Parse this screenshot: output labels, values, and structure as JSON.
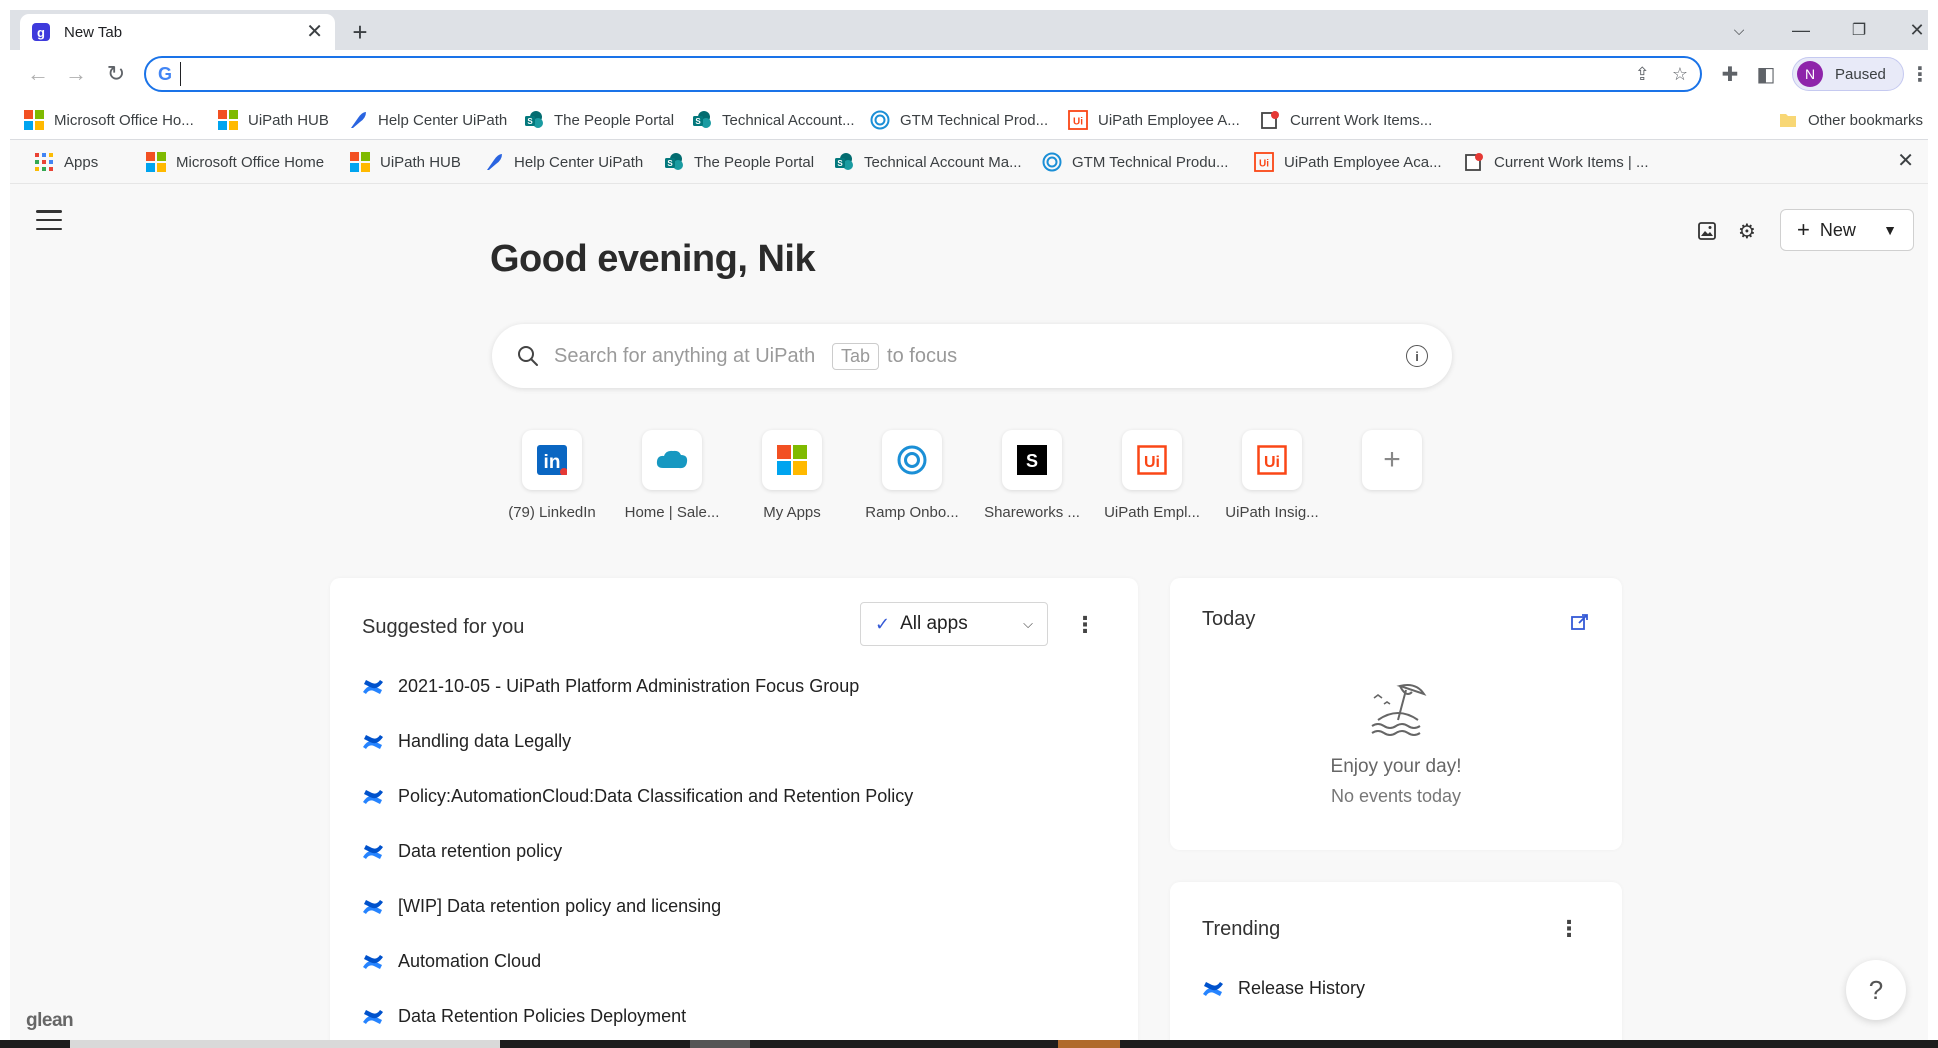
{
  "browser": {
    "tab_title": "New Tab",
    "tab_favicon_letter": "g",
    "omnibox_value": "",
    "profile_initial": "N",
    "profile_status": "Paused",
    "accent": "#1a73e8"
  },
  "bookmarks_bar": {
    "items": [
      {
        "label": "Microsoft Office Ho...",
        "icon": "microsoft-icon"
      },
      {
        "label": "UiPath HUB",
        "icon": "microsoft-icon"
      },
      {
        "label": "Help Center UiPath",
        "icon": "feather-icon"
      },
      {
        "label": "The People Portal",
        "icon": "sharepoint-icon"
      },
      {
        "label": "Technical Account...",
        "icon": "sharepoint-icon"
      },
      {
        "label": "GTM Technical Prod...",
        "icon": "ramp-icon"
      },
      {
        "label": "UiPath Employee A...",
        "icon": "uipath-icon"
      },
      {
        "label": "Current Work Items...",
        "icon": "document-icon"
      }
    ],
    "other_label": "Other bookmarks"
  },
  "app_bar": {
    "items": [
      {
        "label": "Apps",
        "icon": "apps-grid-icon"
      },
      {
        "label": "Microsoft Office Home",
        "icon": "microsoft-icon"
      },
      {
        "label": "UiPath HUB",
        "icon": "microsoft-icon"
      },
      {
        "label": "Help Center UiPath",
        "icon": "feather-icon"
      },
      {
        "label": "The People Portal",
        "icon": "sharepoint-icon"
      },
      {
        "label": "Technical Account Ma...",
        "icon": "sharepoint-icon"
      },
      {
        "label": "GTM Technical Produ...",
        "icon": "ramp-icon"
      },
      {
        "label": "UiPath Employee Aca...",
        "icon": "uipath-icon"
      },
      {
        "label": "Current Work Items | ...",
        "icon": "document-icon"
      }
    ]
  },
  "page": {
    "greeting": "Good evening, Nik",
    "search_placeholder": "Search for anything at UiPath",
    "search_kbd": "Tab",
    "search_focus_hint": "to focus",
    "new_button_label": "New",
    "logo_text": "glean"
  },
  "shortcuts": [
    {
      "label": "(79) LinkedIn",
      "icon": "linkedin-icon"
    },
    {
      "label": "Home | Sale...",
      "icon": "salesforce-icon"
    },
    {
      "label": "My Apps",
      "icon": "microsoft-icon"
    },
    {
      "label": "Ramp Onbo...",
      "icon": "ramp-icon"
    },
    {
      "label": "Shareworks ...",
      "icon": "shareworks-icon"
    },
    {
      "label": "UiPath Empl...",
      "icon": "uipath-icon"
    },
    {
      "label": "UiPath Insig...",
      "icon": "uipath-icon"
    }
  ],
  "suggested": {
    "title": "Suggested for you",
    "filter_label": "All apps",
    "items": [
      "2021-10-05 - UiPath Platform Administration Focus Group",
      "Handling data Legally",
      "Policy:AutomationCloud:Data Classification and Retention Policy",
      "Data retention policy",
      "[WIP] Data retention policy and licensing",
      "Automation Cloud",
      "Data Retention Policies Deployment"
    ]
  },
  "today": {
    "title": "Today",
    "empty_title": "Enjoy your day!",
    "empty_subtitle": "No events today"
  },
  "trending": {
    "title": "Trending",
    "items": [
      "Release History"
    ]
  }
}
